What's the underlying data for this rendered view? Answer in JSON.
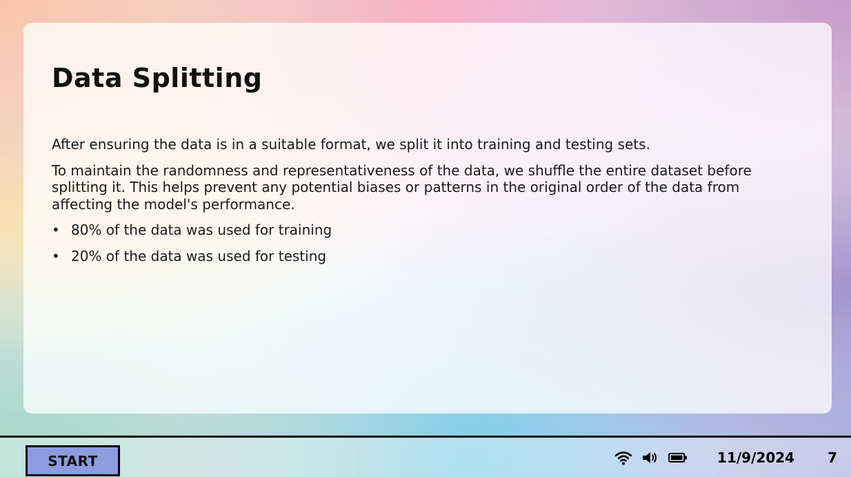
{
  "slide": {
    "title": "Data Splitting",
    "paragraphs": [
      "After ensuring the data is in a suitable format, we split it into training and testing sets.",
      "To maintain the randomness and representativeness of the data, we shuffle the entire dataset before splitting it. This helps prevent any potential biases or patterns in the original order of the data from affecting the model's performance."
    ],
    "bullets": [
      "80% of the data was used for training",
      "20% of the data was used for testing"
    ]
  },
  "taskbar": {
    "start_label": "START",
    "icons": [
      "wifi-icon",
      "speaker-icon",
      "battery-icon"
    ],
    "date": "11/9/2024",
    "notification_count": "7",
    "colors": {
      "start_button": "#8d9be0",
      "border": "#000000"
    }
  }
}
